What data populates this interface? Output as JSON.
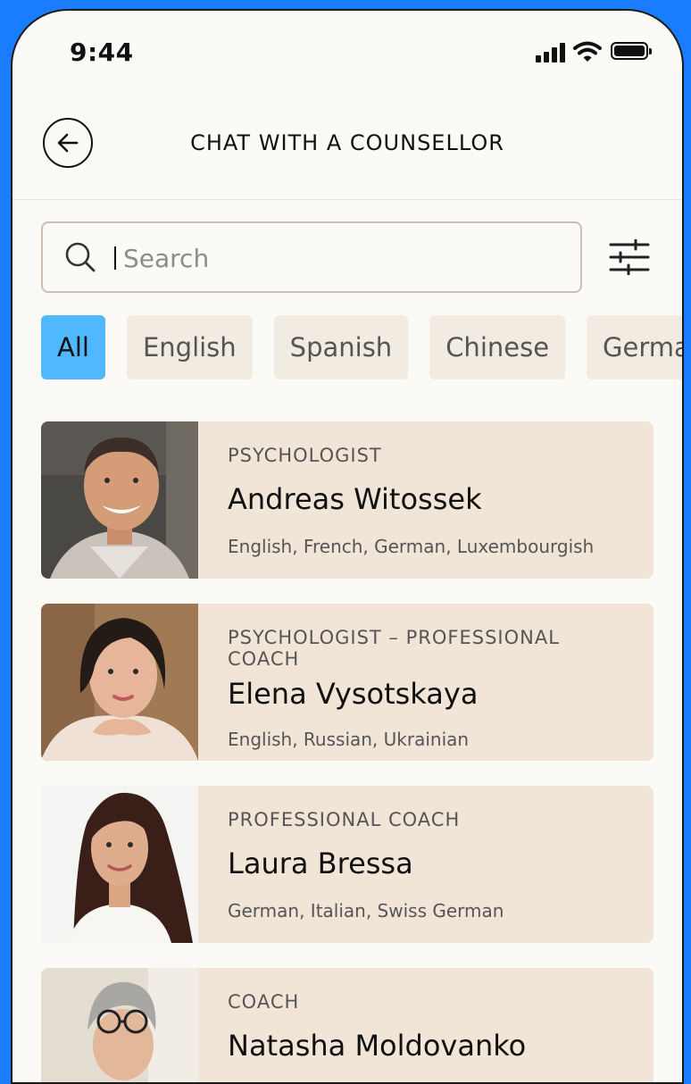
{
  "status_bar": {
    "time": "9:44"
  },
  "header": {
    "title": "CHAT WITH A COUNSELLOR"
  },
  "search": {
    "placeholder": "Search"
  },
  "filters": {
    "chips": [
      "All",
      "English",
      "Spanish",
      "Chinese",
      "German"
    ],
    "selected": "All"
  },
  "counsellors": [
    {
      "role": "PSYCHOLOGIST",
      "name": "Andreas Witossek",
      "languages": "English, French, German, Luxembourgish"
    },
    {
      "role": "PSYCHOLOGIST – PROFESSIONAL COACH",
      "name": "Elena Vysotskaya",
      "languages": "English, Russian, Ukrainian"
    },
    {
      "role": "PROFESSIONAL COACH",
      "name": "Laura Bressa",
      "languages": "German, Italian, Swiss German"
    },
    {
      "role": "COACH",
      "name": "Natasha Moldovanko",
      "languages": ""
    }
  ],
  "colors": {
    "accent": "#4fb8ff",
    "card": "#f0e5d7",
    "chip": "#f1ebe1",
    "frame": "#1a7cff"
  },
  "icons": [
    "back-arrow-icon",
    "search-icon",
    "filter-sliders-icon",
    "signal-icon",
    "wifi-icon",
    "battery-icon"
  ]
}
